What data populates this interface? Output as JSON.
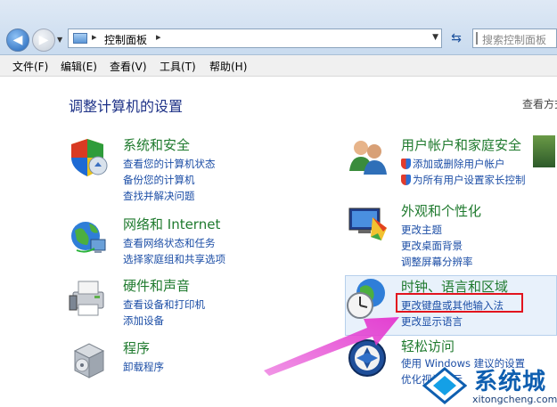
{
  "address": {
    "breadcrumb": "控制面板",
    "sep": "▸",
    "search_placeholder": "搜索控制面板"
  },
  "menu": [
    "文件(F)",
    "编辑(E)",
    "查看(V)",
    "工具(T)",
    "帮助(H)"
  ],
  "page": {
    "title": "调整计算机的设置",
    "view_by": "查看方式"
  },
  "categories": {
    "security": {
      "title": "系统和安全",
      "links": [
        "查看您的计算机状态",
        "备份您的计算机",
        "查找并解决问题"
      ]
    },
    "network": {
      "title": "网络和 Internet",
      "links": [
        "查看网络状态和任务",
        "选择家庭组和共享选项"
      ]
    },
    "hardware": {
      "title": "硬件和声音",
      "links": [
        "查看设备和打印机",
        "添加设备"
      ]
    },
    "programs": {
      "title": "程序",
      "links": [
        "卸载程序"
      ]
    },
    "users": {
      "title": "用户帐户和家庭安全",
      "links": [
        "添加或删除用户帐户",
        "为所有用户设置家长控制"
      ]
    },
    "appearance": {
      "title": "外观和个性化",
      "links": [
        "更改主题",
        "更改桌面背景",
        "调整屏幕分辨率"
      ]
    },
    "clock": {
      "title": "时钟、语言和区域",
      "links": [
        "更改键盘或其他输入法",
        "更改显示语言"
      ]
    },
    "ease": {
      "title": "轻松访问",
      "links": [
        "使用 Windows 建议的设置",
        "优化视觉显示"
      ]
    }
  },
  "watermark": {
    "text": "系统城",
    "url": "xitongcheng.com"
  },
  "colors": {
    "title_green": "#1f7a2e",
    "link_blue": "#1c4ea6",
    "highlight_red": "#e2141e",
    "arrow_magenta": "#e43fd1"
  }
}
